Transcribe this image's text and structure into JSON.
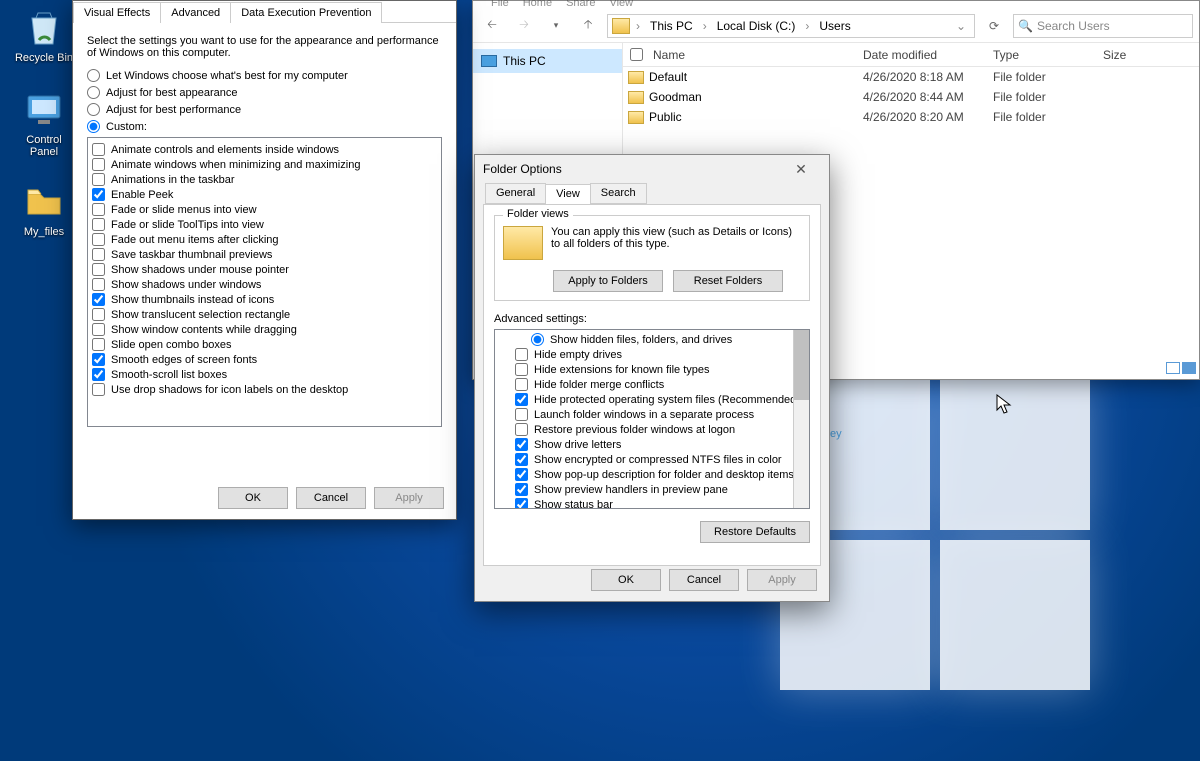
{
  "desktop_icons": {
    "recycle": "Recycle Bin",
    "cpanel": "Control\nPanel",
    "myfiles": "My_files"
  },
  "explorer": {
    "ribbon_tabs": [
      "File",
      "Home",
      "Share",
      "View"
    ],
    "crumbs": [
      "This PC",
      "Local Disk (C:)",
      "Users"
    ],
    "search_placeholder": "Search Users",
    "navpane_item": "This PC",
    "columns": {
      "name": "Name",
      "date": "Date modified",
      "type": "Type",
      "size": "Size"
    },
    "rows": [
      {
        "name": "Default",
        "date": "4/26/2020 8:18 AM",
        "type": "File folder"
      },
      {
        "name": "Goodman",
        "date": "4/26/2020 8:44 AM",
        "type": "File folder"
      },
      {
        "name": "Public",
        "date": "4/26/2020 8:20 AM",
        "type": "File folder"
      }
    ],
    "key_hint": "ey"
  },
  "perf": {
    "tabs": [
      "Visual Effects",
      "Advanced",
      "Data Execution Prevention"
    ],
    "intro": "Select the settings you want to use for the appearance and performance of Windows on this computer.",
    "radios": [
      "Let Windows choose what's best for my computer",
      "Adjust for best appearance",
      "Adjust for best performance",
      "Custom:"
    ],
    "radio_selected": 3,
    "items": [
      {
        "label": "Animate controls and elements inside windows",
        "checked": false
      },
      {
        "label": "Animate windows when minimizing and maximizing",
        "checked": false
      },
      {
        "label": "Animations in the taskbar",
        "checked": false
      },
      {
        "label": "Enable Peek",
        "checked": true
      },
      {
        "label": "Fade or slide menus into view",
        "checked": false
      },
      {
        "label": "Fade or slide ToolTips into view",
        "checked": false
      },
      {
        "label": "Fade out menu items after clicking",
        "checked": false
      },
      {
        "label": "Save taskbar thumbnail previews",
        "checked": false
      },
      {
        "label": "Show shadows under mouse pointer",
        "checked": false
      },
      {
        "label": "Show shadows under windows",
        "checked": false
      },
      {
        "label": "Show thumbnails instead of icons",
        "checked": true
      },
      {
        "label": "Show translucent selection rectangle",
        "checked": false
      },
      {
        "label": "Show window contents while dragging",
        "checked": false
      },
      {
        "label": "Slide open combo boxes",
        "checked": false
      },
      {
        "label": "Smooth edges of screen fonts",
        "checked": true
      },
      {
        "label": "Smooth-scroll list boxes",
        "checked": true
      },
      {
        "label": "Use drop shadows for icon labels on the desktop",
        "checked": false
      }
    ],
    "btns": {
      "ok": "OK",
      "cancel": "Cancel",
      "apply": "Apply"
    }
  },
  "fopts": {
    "title": "Folder Options",
    "tabs": [
      "General",
      "View",
      "Search"
    ],
    "active_tab": 1,
    "fv_legend": "Folder views",
    "fv_desc": "You can apply this view (such as Details or Icons) to all folders of this type.",
    "fv_apply": "Apply to Folders",
    "fv_reset": "Reset Folders",
    "adv_label": "Advanced settings:",
    "adv_items": [
      {
        "kind": "radio",
        "label": "Show hidden files, folders, and drives",
        "checked": true
      },
      {
        "kind": "check",
        "label": "Hide empty drives",
        "checked": false
      },
      {
        "kind": "check",
        "label": "Hide extensions for known file types",
        "checked": false
      },
      {
        "kind": "check",
        "label": "Hide folder merge conflicts",
        "checked": false
      },
      {
        "kind": "check",
        "label": "Hide protected operating system files (Recommended)",
        "checked": true
      },
      {
        "kind": "check",
        "label": "Launch folder windows in a separate process",
        "checked": false
      },
      {
        "kind": "check",
        "label": "Restore previous folder windows at logon",
        "checked": false
      },
      {
        "kind": "check",
        "label": "Show drive letters",
        "checked": true
      },
      {
        "kind": "check",
        "label": "Show encrypted or compressed NTFS files in color",
        "checked": true
      },
      {
        "kind": "check",
        "label": "Show pop-up description for folder and desktop items",
        "checked": true
      },
      {
        "kind": "check",
        "label": "Show preview handlers in preview pane",
        "checked": true
      },
      {
        "kind": "check",
        "label": "Show status bar",
        "checked": true
      }
    ],
    "restore": "Restore Defaults",
    "btns": {
      "ok": "OK",
      "cancel": "Cancel",
      "apply": "Apply"
    }
  }
}
